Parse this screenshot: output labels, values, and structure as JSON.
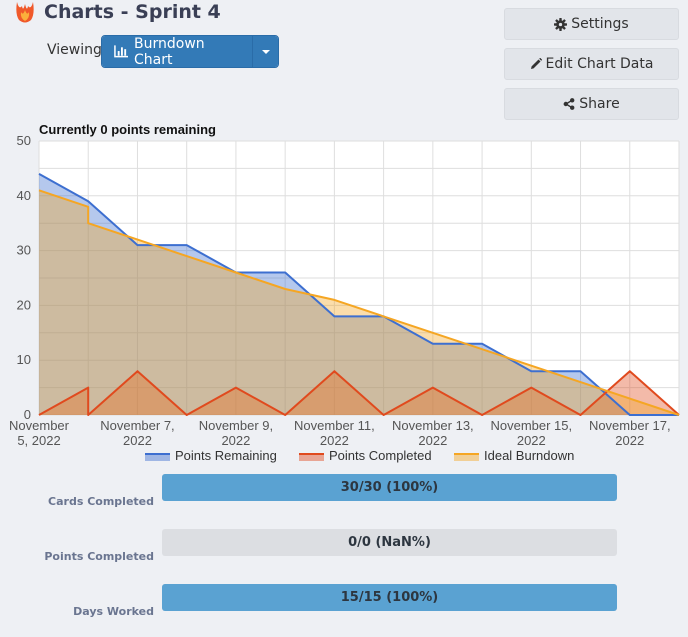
{
  "header": {
    "title": "Charts - Sprint 4",
    "viewing_label": "Viewing",
    "chart_selector": {
      "selected": "Burndown Chart"
    }
  },
  "actions": {
    "settings": "Settings",
    "edit_chart_data": "Edit Chart Data",
    "share": "Share"
  },
  "chart_data": {
    "type": "line",
    "title": "Currently 0 points remaining",
    "xlabel": "",
    "ylabel": "",
    "ylim": [
      0,
      50
    ],
    "yticks": [
      0,
      10,
      20,
      30,
      40,
      50
    ],
    "xlim": [
      "2022-11-05",
      "2022-11-18"
    ],
    "xtick_labels": [
      [
        "November",
        "5, 2022"
      ],
      [
        "November 7,",
        "2022"
      ],
      [
        "November 9,",
        "2022"
      ],
      [
        "November 11,",
        "2022"
      ],
      [
        "November 13,",
        "2022"
      ],
      [
        "November 15,",
        "2022"
      ],
      [
        "November 17,",
        "2022"
      ]
    ],
    "xtick_dates": [
      "2022-11-05",
      "2022-11-07",
      "2022-11-09",
      "2022-11-11",
      "2022-11-13",
      "2022-11-15",
      "2022-11-17"
    ],
    "grid": true,
    "legend_position": "bottom",
    "series": [
      {
        "name": "Points Remaining",
        "color": "#3d6fd0",
        "points": [
          [
            "2022-11-05",
            44
          ],
          [
            "2022-11-06",
            39
          ],
          [
            "2022-11-07",
            31
          ],
          [
            "2022-11-08",
            31
          ],
          [
            "2022-11-09",
            26
          ],
          [
            "2022-11-10",
            26
          ],
          [
            "2022-11-11",
            18
          ],
          [
            "2022-11-12",
            18
          ],
          [
            "2022-11-13",
            13
          ],
          [
            "2022-11-14",
            13
          ],
          [
            "2022-11-15",
            8
          ],
          [
            "2022-11-16",
            8
          ],
          [
            "2022-11-17",
            0
          ],
          [
            "2022-11-18",
            0
          ]
        ]
      },
      {
        "name": "Points Completed",
        "color": "#e04a1e",
        "points": [
          [
            "2022-11-05",
            0
          ],
          [
            "2022-11-06",
            5
          ],
          [
            "2022-11-06",
            0
          ],
          [
            "2022-11-07",
            8
          ],
          [
            "2022-11-08",
            0
          ],
          [
            "2022-11-09",
            5
          ],
          [
            "2022-11-10",
            0
          ],
          [
            "2022-11-11",
            8
          ],
          [
            "2022-11-12",
            0
          ],
          [
            "2022-11-13",
            5
          ],
          [
            "2022-11-14",
            0
          ],
          [
            "2022-11-15",
            5
          ],
          [
            "2022-11-16",
            0
          ],
          [
            "2022-11-17",
            8
          ],
          [
            "2022-11-18",
            0
          ]
        ]
      },
      {
        "name": "Ideal Burndown",
        "color": "#f5a623",
        "points": [
          [
            "2022-11-05",
            41
          ],
          [
            "2022-11-06",
            38
          ],
          [
            "2022-11-06",
            35
          ],
          [
            "2022-11-07",
            32
          ],
          [
            "2022-11-08",
            29
          ],
          [
            "2022-11-09",
            26
          ],
          [
            "2022-11-10",
            23
          ],
          [
            "2022-11-11",
            21
          ],
          [
            "2022-11-12",
            18
          ],
          [
            "2022-11-13",
            15
          ],
          [
            "2022-11-14",
            12
          ],
          [
            "2022-11-15",
            9
          ],
          [
            "2022-11-16",
            6
          ],
          [
            "2022-11-17",
            3
          ],
          [
            "2022-11-18",
            0
          ]
        ]
      }
    ]
  },
  "stats": [
    {
      "label": "Cards Completed",
      "text": "30/30 (100%)",
      "fraction": 1.0
    },
    {
      "label": "Points Completed",
      "text": "0/0 (NaN%)",
      "fraction": 0
    },
    {
      "label": "Days Worked",
      "text": "15/15 (100%)",
      "fraction": 1.0
    }
  ],
  "colors": {
    "primary_button": "#337ab7",
    "progress_fill": "#5aa2d2",
    "progress_track": "#dcdee2"
  }
}
